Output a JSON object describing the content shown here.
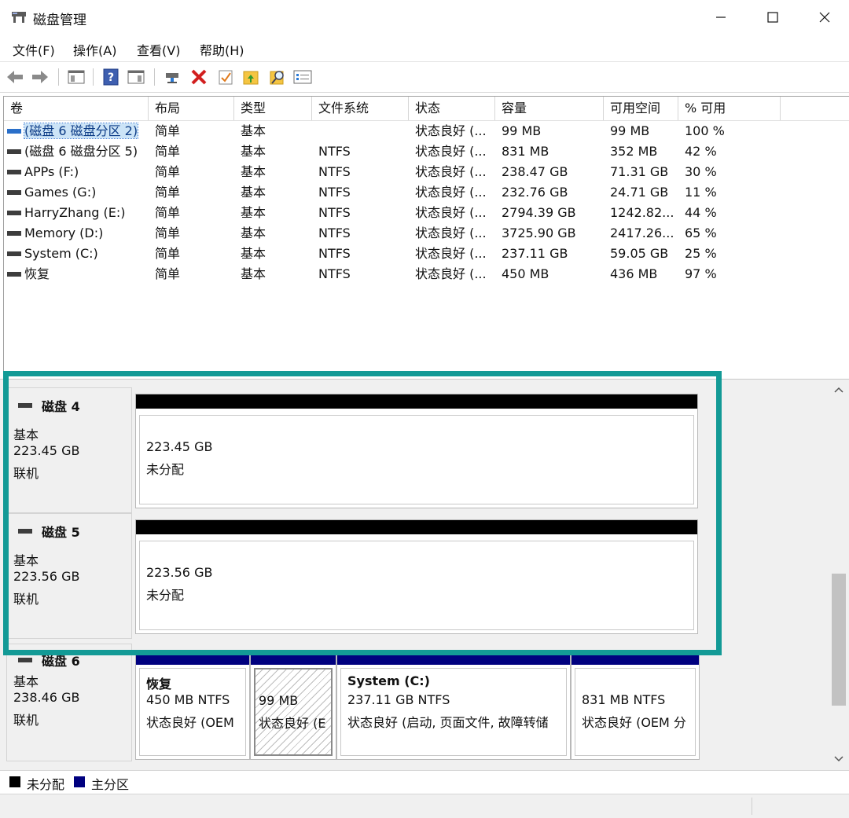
{
  "window": {
    "title": "磁盘管理",
    "icon": "disk-management-icon",
    "controls": {
      "minimize": "—",
      "maximize": "☐",
      "close": "✕"
    }
  },
  "menu": {
    "items": [
      {
        "label": "文件(F)"
      },
      {
        "label": "操作(A)"
      },
      {
        "label": "查看(V)"
      },
      {
        "label": "帮助(H)"
      }
    ]
  },
  "toolbar": {
    "buttons": [
      "back-arrow-icon",
      "forward-arrow-icon",
      "console-tree-icon",
      "help-icon",
      "action-pane-icon",
      "connect-disk-icon",
      "delete-icon",
      "check-icon",
      "folder-up-icon",
      "search-folder-icon",
      "properties-icon"
    ]
  },
  "volume_table": {
    "columns": [
      "卷",
      "布局",
      "类型",
      "文件系统",
      "状态",
      "容量",
      "可用空间",
      "% 可用"
    ],
    "rows": [
      {
        "volume": "(磁盘 6 磁盘分区 2)",
        "layout": "简单",
        "type": "基本",
        "fs": "",
        "status": "状态良好 (...",
        "capacity": "99 MB",
        "free": "99 MB",
        "pct": "100 %"
      },
      {
        "volume": "(磁盘 6 磁盘分区 5)",
        "layout": "简单",
        "type": "基本",
        "fs": "NTFS",
        "status": "状态良好 (...",
        "capacity": "831 MB",
        "free": "352 MB",
        "pct": "42 %"
      },
      {
        "volume": "APPs (F:)",
        "layout": "简单",
        "type": "基本",
        "fs": "NTFS",
        "status": "状态良好 (...",
        "capacity": "238.47 GB",
        "free": "71.31 GB",
        "pct": "30 %"
      },
      {
        "volume": "Games (G:)",
        "layout": "简单",
        "type": "基本",
        "fs": "NTFS",
        "status": "状态良好 (...",
        "capacity": "232.76 GB",
        "free": "24.71 GB",
        "pct": "11 %"
      },
      {
        "volume": "HarryZhang (E:)",
        "layout": "简单",
        "type": "基本",
        "fs": "NTFS",
        "status": "状态良好 (...",
        "capacity": "2794.39 GB",
        "free": "1242.82...",
        "pct": "44 %"
      },
      {
        "volume": "Memory (D:)",
        "layout": "简单",
        "type": "基本",
        "fs": "NTFS",
        "status": "状态良好 (...",
        "capacity": "3725.90 GB",
        "free": "2417.26...",
        "pct": "65 %"
      },
      {
        "volume": "System (C:)",
        "layout": "简单",
        "type": "基本",
        "fs": "NTFS",
        "status": "状态良好 (...",
        "capacity": "237.11 GB",
        "free": "59.05 GB",
        "pct": "25 %"
      },
      {
        "volume": "恢复",
        "layout": "简单",
        "type": "基本",
        "fs": "NTFS",
        "status": "状态良好 (...",
        "capacity": "450 MB",
        "free": "436 MB",
        "pct": "97 %"
      }
    ]
  },
  "disks": [
    {
      "name": "磁盘 4",
      "type": "基本",
      "size": "223.45 GB",
      "state": "联机",
      "partitions": [
        {
          "line1": "223.45 GB",
          "line2": "未分配"
        }
      ]
    },
    {
      "name": "磁盘 5",
      "type": "基本",
      "size": "223.56 GB",
      "state": "联机",
      "partitions": [
        {
          "line1": "223.56 GB",
          "line2": "未分配"
        }
      ]
    },
    {
      "name": "磁盘 6",
      "type": "基本",
      "size": "238.46 GB",
      "state": "联机",
      "partitions": [
        {
          "title": "恢复",
          "line1": "450 MB NTFS",
          "line2": "状态良好 (OEM"
        },
        {
          "title": "",
          "line1": "99 MB",
          "line2": "状态良好 (E"
        },
        {
          "title": "System  (C:)",
          "line1": "237.11 GB NTFS",
          "line2": "状态良好 (启动, 页面文件, 故障转储"
        },
        {
          "title": "",
          "line1": "831 MB NTFS",
          "line2": "状态良好 (OEM 分"
        }
      ]
    }
  ],
  "legend": [
    {
      "label": "未分配",
      "color": "#000000"
    },
    {
      "label": "主分区",
      "color": "#00007f"
    }
  ],
  "colors": {
    "highlight": "#139a96",
    "unallocated": "#000000",
    "primary": "#00007f",
    "selection": "#cce4f7"
  }
}
